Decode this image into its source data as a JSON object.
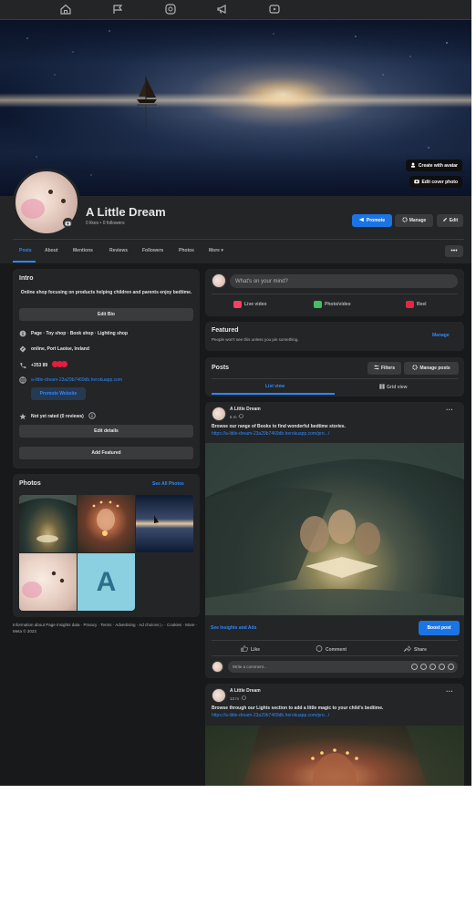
{
  "topnav": {
    "items": [
      {
        "name": "home",
        "icon": "home-icon"
      },
      {
        "name": "flag",
        "icon": "flag-icon"
      },
      {
        "name": "insights",
        "icon": "insights-icon"
      },
      {
        "name": "megaphone",
        "icon": "megaphone-icon"
      },
      {
        "name": "video",
        "icon": "video-icon"
      }
    ]
  },
  "cover": {
    "create_avatar_label": "Create with avatar",
    "edit_cover_label": "Edit cover photo"
  },
  "page": {
    "name": "A Little Dream",
    "stats": "0 likes • 0 followers"
  },
  "header_buttons": {
    "promote": "Promote",
    "manage": "Manage",
    "edit": "Edit"
  },
  "tabs": [
    {
      "label": "Posts",
      "active": true
    },
    {
      "label": "About",
      "active": false
    },
    {
      "label": "Mentions",
      "active": false
    },
    {
      "label": "Reviews",
      "active": false
    },
    {
      "label": "Followers",
      "active": false
    },
    {
      "label": "Photos",
      "active": false
    },
    {
      "label": "More ▾",
      "active": false
    }
  ],
  "more_button": "•••",
  "intro": {
    "title": "Intro",
    "bio": "Online shop focusing on products helping children and parents enjoy bedtime.",
    "edit_bio": "Edit Bio",
    "category": "Page · Toy shop · Book shop · Lighting shop",
    "location": "online, Port Laoise, Ireland",
    "phone": "+353 89",
    "website": "a-little-dream-23a29b7469db.herokuapp.com",
    "promote_website": "Promote Website",
    "rating": "Not yet rated (0 reviews)",
    "edit_details": "Edit details",
    "add_featured": "Add Featured"
  },
  "photos": {
    "title": "Photos",
    "see_all": "See All Photos",
    "placeholder_letter": "A"
  },
  "footer": "Information about Page Insights data · Privacy · Terms · Advertising · Ad choices ▷ · Cookies · More · Meta © 2023",
  "composer": {
    "placeholder": "What's on your mind?",
    "live_video": "Live video",
    "photo_video": "Photo/video",
    "reel": "Reel"
  },
  "featured": {
    "title": "Featured",
    "subtitle": "People won't see this unless you pin something.",
    "manage": "Manage"
  },
  "posts_section": {
    "title": "Posts",
    "filters": "Filters",
    "manage_posts": "Manage posts",
    "list_view": "List view",
    "grid_view": "Grid view"
  },
  "posts": [
    {
      "author": "A Little Dream",
      "time": "6 m · ",
      "text": "Browse our range of Books to find wonderful bedtime stories.",
      "url": "https://a-little-dream-23a29b7469db.herokuapp.com/pro.../",
      "insights": "See Insights and Ads",
      "boost": "Boost post",
      "like": "Like",
      "comment": "Comment",
      "share": "Share",
      "comment_placeholder": "Write a comment..."
    },
    {
      "author": "A Little Dream",
      "time": "13 m · ",
      "text": "Browse through our Lights section to add a little magic to your child's bedtime.",
      "url": "https://a-little-dream-23a29b7469db.herokuapp.com/pro.../"
    }
  ],
  "colors": {
    "background": "#18191a",
    "card": "#242526",
    "accent": "#1b74e4",
    "link": "#2d88ff",
    "text": "#e4e6eb",
    "muted": "#b0b3b8"
  }
}
